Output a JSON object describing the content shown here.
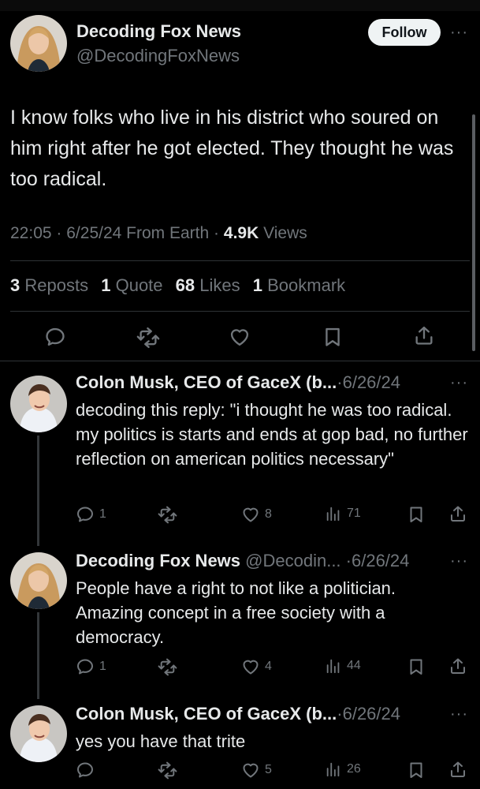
{
  "main_tweet": {
    "author_name": "Decoding Fox News",
    "handle": "@DecodingFoxNews",
    "follow_label": "Follow",
    "more": "···",
    "text": "I know folks who live in his district who soured on him right after he got elected. They thought he was too radical.",
    "time": "22:05",
    "date": "6/25/24",
    "source": "From Earth",
    "views_count": "4.9K",
    "views_label": "Views",
    "sep": "·",
    "reposts_count": "3",
    "reposts_label": "Reposts",
    "quotes_count": "1",
    "quotes_label": "Quote",
    "likes_count": "68",
    "likes_label": "Likes",
    "bookmarks_count": "1",
    "bookmarks_label": "Bookmark"
  },
  "replies": [
    {
      "name": "Colon Musk, CEO of GaceX (b...",
      "sub": "·6/26/24",
      "text": "decoding this reply: \"i thought he was too radical. my politics is starts and ends at gop bad, no further reflection on american politics necessary\"",
      "replies": "1",
      "likes": "8",
      "views": "71"
    },
    {
      "name": "Decoding Fox News",
      "sub": " @Decodin... ·6/26/24",
      "text": "People have a right to not like a politician. Amazing concept in a free society with a democracy.",
      "replies": "1",
      "likes": "4",
      "views": "44"
    },
    {
      "name": "Colon Musk, CEO of GaceX (b...",
      "sub": "·6/26/24",
      "text": "yes you have that trite",
      "replies": "",
      "likes": "5",
      "views": "26"
    }
  ],
  "icons": {
    "reply": "reply-icon",
    "repost": "repost-icon",
    "like": "heart-icon",
    "bookmark": "bookmark-icon",
    "share": "share-icon",
    "views": "views-icon",
    "more": "more-icon"
  },
  "colors": {
    "background": "#000000",
    "text_primary": "#e7e9ea",
    "text_secondary": "#71767b",
    "divider": "#2f3336",
    "follow_bg": "#eff3f4"
  }
}
